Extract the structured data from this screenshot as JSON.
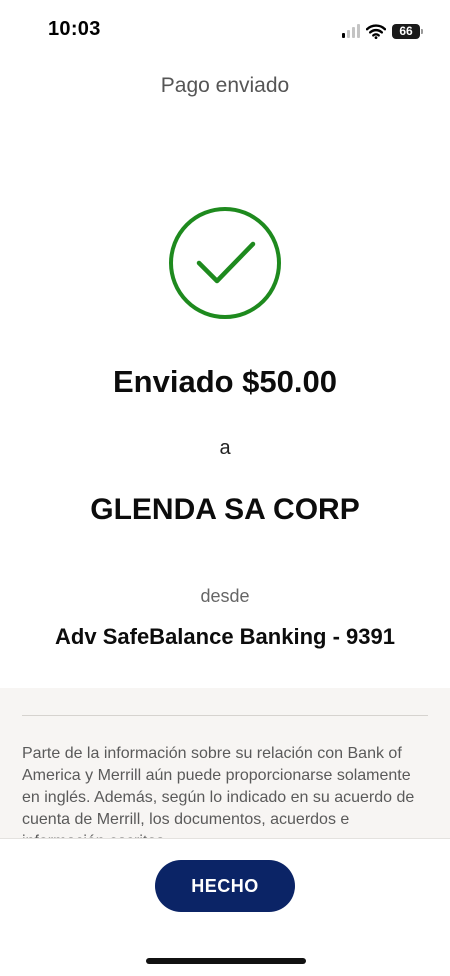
{
  "status_bar": {
    "time": "10:03",
    "battery": "66",
    "icons": [
      "cellular-signal-icon",
      "wifi-icon",
      "battery-icon"
    ]
  },
  "header": {
    "title": "Pago enviado"
  },
  "confirmation": {
    "icon": "checkmark-circle-icon",
    "icon_color": "#1e8a1e",
    "sent_amount": "Enviado $50.00",
    "to_label": "a",
    "recipient": "GLENDA SA CORP",
    "from_label": "desde",
    "account": "Adv SafeBalance Banking - 9391"
  },
  "disclosure": {
    "text": "Parte de la información sobre su relación con Bank of America y Merrill aún puede proporcionarse solamente en inglés. Además, según lo indicado en su acuerdo de cuenta de Merrill, los documentos, acuerdos e información escritos"
  },
  "footer": {
    "done_label": "HECHO",
    "done_color": "#0b2466"
  }
}
